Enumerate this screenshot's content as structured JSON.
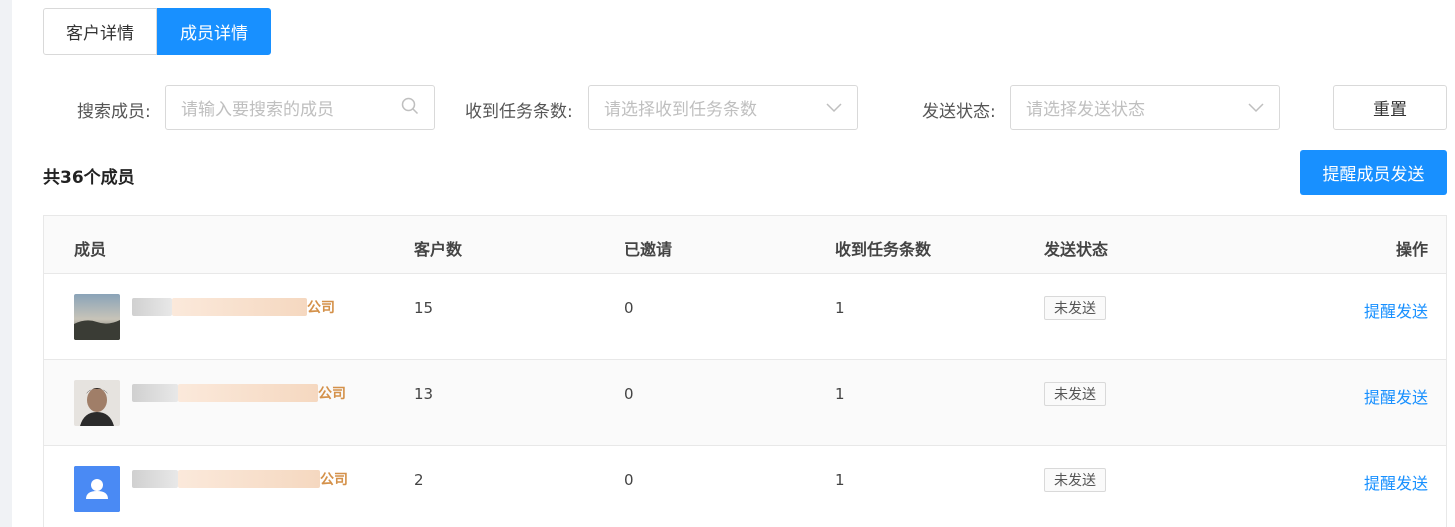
{
  "tabs": [
    {
      "label": "客户详情",
      "active": false
    },
    {
      "label": "成员详情",
      "active": true
    }
  ],
  "filters": {
    "search": {
      "label": "搜索成员:",
      "placeholder": "请输入要搜索的成员"
    },
    "tasks": {
      "label": "收到任务条数:",
      "placeholder": "请选择收到任务条数"
    },
    "status": {
      "label": "发送状态:",
      "placeholder": "请选择发送状态"
    },
    "reset_label": "重置"
  },
  "summary": {
    "total_text": "共36个成员",
    "remind_all_label": "提醒成员发送"
  },
  "table": {
    "headers": {
      "member": "成员",
      "customers": "客户数",
      "invited": "已邀请",
      "tasks": "收到任务条数",
      "status": "发送状态",
      "actions": "操作"
    },
    "rows": [
      {
        "company": "公司",
        "customers": "15",
        "invited": "0",
        "tasks": "1",
        "status": "未发送",
        "action": "提醒发送"
      },
      {
        "company": "公司",
        "customers": "13",
        "invited": "0",
        "tasks": "1",
        "status": "未发送",
        "action": "提醒发送"
      },
      {
        "company": "公司",
        "customers": "2",
        "invited": "0",
        "tasks": "1",
        "status": "未发送",
        "action": "提醒发送"
      }
    ]
  },
  "colors": {
    "primary": "#1890ff",
    "company": "#d4914a"
  }
}
